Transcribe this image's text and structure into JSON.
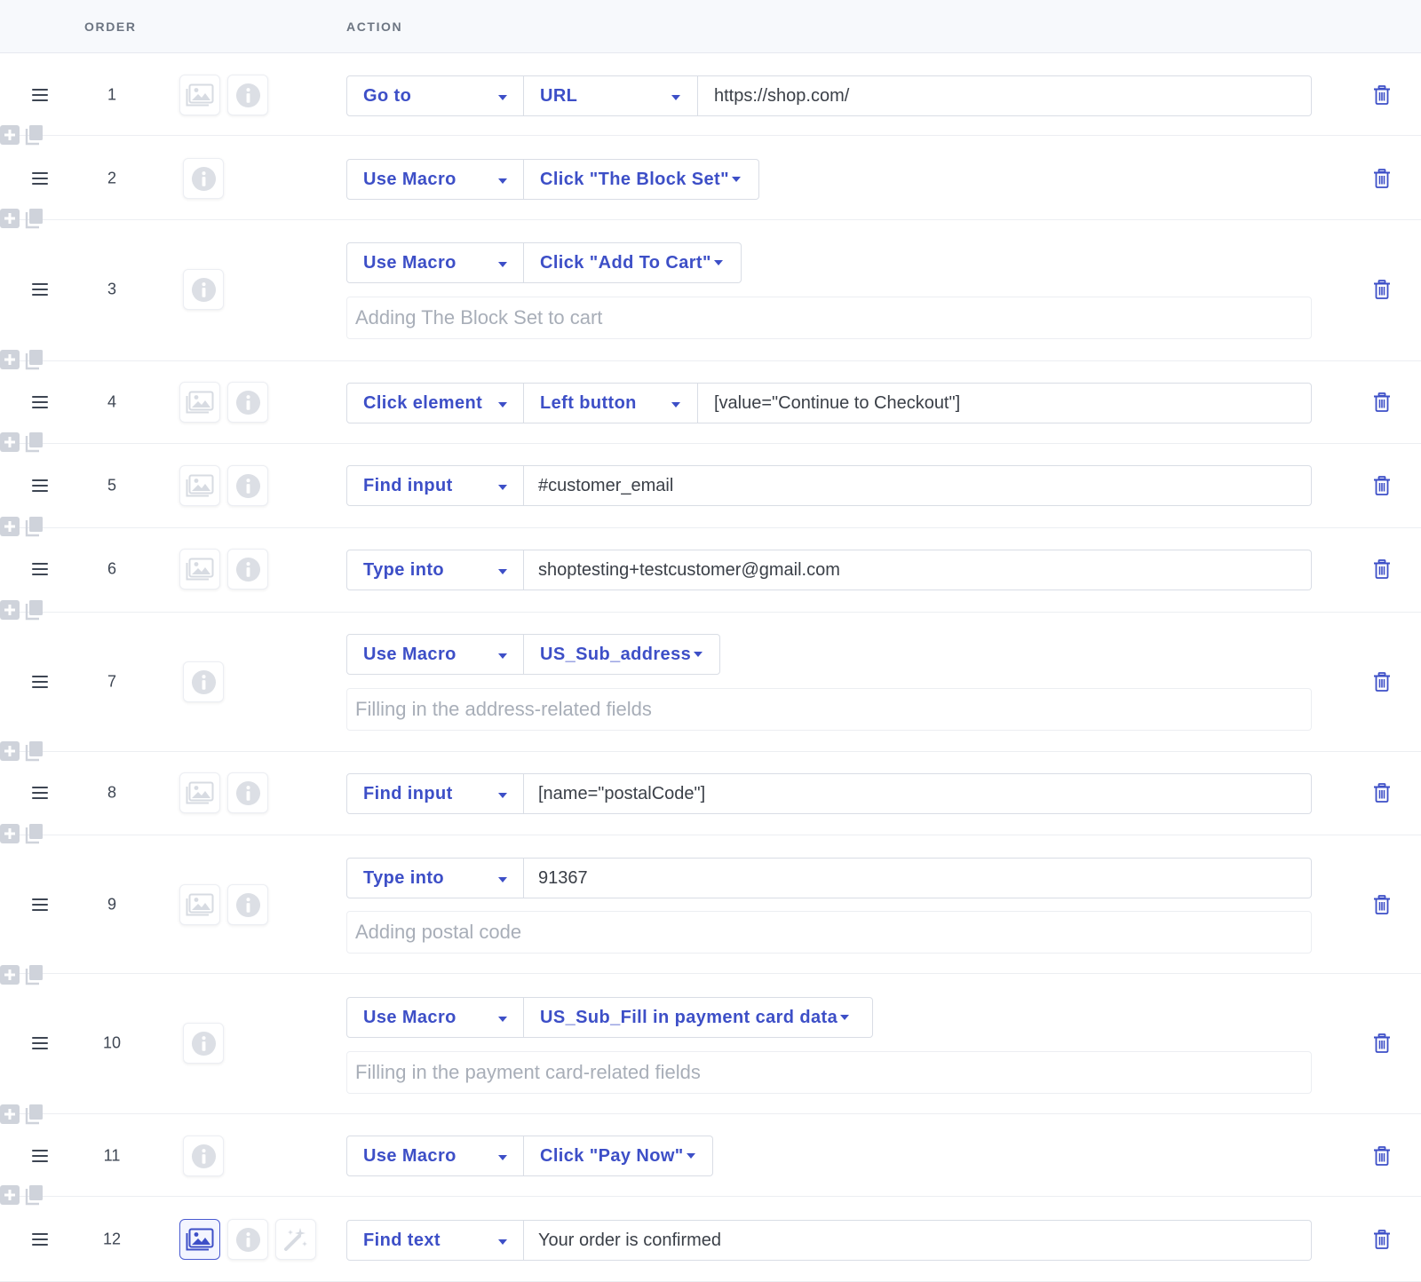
{
  "header": {
    "order_label": "ORDER",
    "action_label": "ACTION"
  },
  "icons": {
    "drag": "drag-handle-icon",
    "screenshot": "image-icon",
    "info": "info-icon",
    "magic": "magic-wand-icon",
    "delete": "trash-icon",
    "insert": "plus-square-icon",
    "duplicate": "copy-icon"
  },
  "colors": {
    "accent": "#3d4fc7",
    "muted_icon": "#d7dbe2",
    "header_bg": "#f7f9fc"
  },
  "rows": [
    {
      "order": "1",
      "action": "Go to",
      "option": "URL",
      "value": "https://shop.com/"
    },
    {
      "order": "2",
      "action": "Use Macro",
      "option": "Click \"The Block Set\""
    },
    {
      "order": "3",
      "action": "Use Macro",
      "option": "Click \"Add To Cart\"",
      "comment": "Adding The Block Set to cart"
    },
    {
      "order": "4",
      "action": "Click element",
      "option": "Left button",
      "value": "[value=\"Continue to Checkout\"]"
    },
    {
      "order": "5",
      "action": "Find input",
      "value": "#customer_email"
    },
    {
      "order": "6",
      "action": "Type into",
      "value": "shoptesting+testcustomer@gmail.com"
    },
    {
      "order": "7",
      "action": "Use Macro",
      "option": "US_Sub_address",
      "comment": "Filling in the address-related fields"
    },
    {
      "order": "8",
      "action": "Find input",
      "value": "[name=\"postalCode\"]"
    },
    {
      "order": "9",
      "action": "Type into",
      "value": "91367",
      "comment": "Adding postal code"
    },
    {
      "order": "10",
      "action": "Use Macro",
      "option": "US_Sub_Fill in payment card data",
      "comment": "Filling in the payment card-related fields"
    },
    {
      "order": "11",
      "action": "Use Macro",
      "option": "Click \"Pay Now\""
    },
    {
      "order": "12",
      "action": "Find text",
      "value": "Your order is confirmed"
    }
  ]
}
